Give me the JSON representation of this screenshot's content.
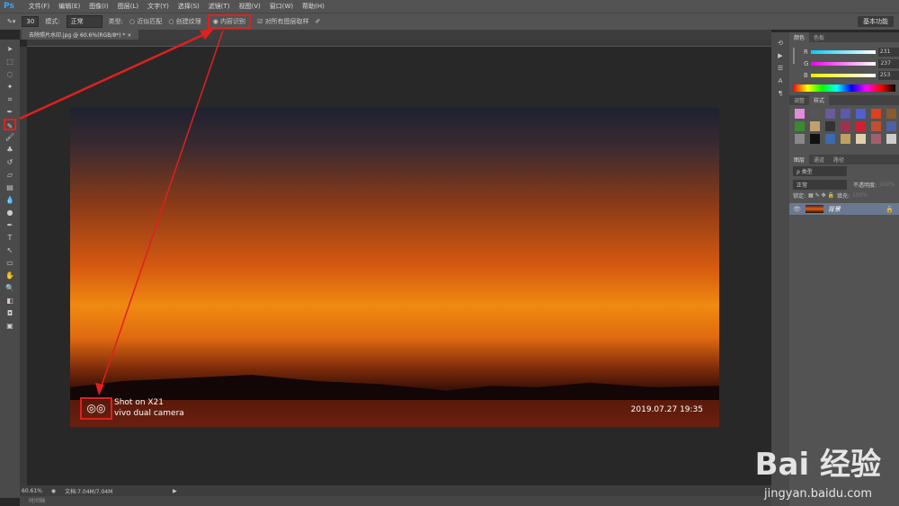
{
  "app": {
    "logo": "Ps"
  },
  "menu": [
    "文件(F)",
    "编辑(E)",
    "图像(I)",
    "图层(L)",
    "文字(Y)",
    "选择(S)",
    "滤镜(T)",
    "视图(V)",
    "窗口(W)",
    "帮助(H)"
  ],
  "options": {
    "brush_size": "30",
    "mode_label": "模式:",
    "mode_value": "正常",
    "type_label": "类型:",
    "type_options": [
      "近似匹配",
      "创建纹理",
      "内容识别"
    ],
    "selected_type": "内容识别",
    "sample_all": "对所有图层取样",
    "workspace": "基本功能"
  },
  "document": {
    "tab": "去除照片水印.jpg @ 60.6%(RGB/8*) *",
    "zoom": "60.61%",
    "doc_info": "文档:7.04M/7.04M"
  },
  "timeline": "时间轴",
  "photo": {
    "watermark_line1": "Shot on X21",
    "watermark_line2": "vivo dual camera",
    "datetime": "2019.07.27 19:35",
    "watermark_logo": "◎◎"
  },
  "color_panel": {
    "tabs": [
      "颜色",
      "色板"
    ],
    "r_label": "R",
    "g_label": "G",
    "b_label": "B",
    "r": "231",
    "g": "237",
    "b": "253"
  },
  "styles_panel": {
    "tabs": [
      "调整",
      "样式"
    ]
  },
  "layers_panel": {
    "tabs": [
      "图层",
      "通道",
      "路径"
    ],
    "filter": "ρ 类型",
    "blend": "正常",
    "opacity_label": "不透明度:",
    "opacity": "100%",
    "lock_label": "锁定:",
    "fill_label": "填充:",
    "fill": "100%",
    "layer_name": "背景"
  },
  "watermark": {
    "brand": "Bai 经验",
    "url": "jingyan.baidu.com"
  },
  "colors": {
    "annotation": "#e02020",
    "ps_blue": "#31a8ff"
  }
}
